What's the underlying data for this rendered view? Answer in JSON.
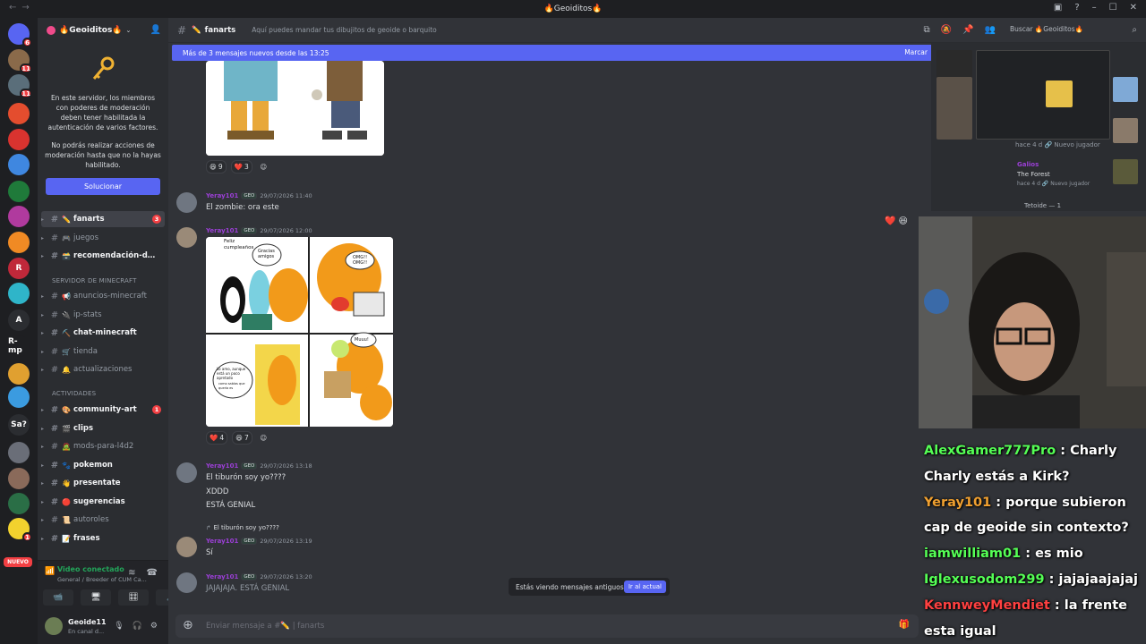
{
  "window": {
    "title": "🔥Geoiditos🔥"
  },
  "guild_rail": {
    "items": [
      {
        "label": "",
        "color": "#5865f2",
        "badge": "6"
      },
      {
        "label": "",
        "color": "#8a6a4a",
        "badge": "11"
      },
      {
        "label": "",
        "color": "#5a6e7a",
        "badge": "11"
      },
      {
        "label": "",
        "color": "#e44d2e",
        "badge": ""
      },
      {
        "label": "",
        "color": "#d9332f",
        "badge": ""
      },
      {
        "label": "",
        "color": "#3f87e0",
        "badge": ""
      },
      {
        "label": "",
        "color": "#1f7a3a",
        "badge": ""
      },
      {
        "label": "",
        "color": "#b03a9e",
        "badge": ""
      },
      {
        "label": "",
        "color": "#f08a24",
        "badge": ""
      },
      {
        "label": "R",
        "color": "#c0283a",
        "badge": ""
      },
      {
        "label": "",
        "color": "#2fb5c9",
        "badge": ""
      },
      {
        "label": "A",
        "color": "#2b2d31",
        "badge": ""
      },
      {
        "label": "R-mp",
        "color": "#1e1f22",
        "badge": ""
      },
      {
        "label": "",
        "color": "#e0a030",
        "badge": ""
      },
      {
        "label": "",
        "color": "#3b9be0",
        "badge": ""
      },
      {
        "label": "Sa?",
        "color": "#2b2d31",
        "badge": ""
      },
      {
        "label": "",
        "color": "#6a6e78",
        "badge": ""
      },
      {
        "label": "",
        "color": "#8a6a5a",
        "badge": ""
      },
      {
        "label": "",
        "color": "#2a6e46",
        "badge": ""
      },
      {
        "label": "",
        "color": "#f2d22e",
        "badge": "1"
      }
    ],
    "nuevo": "NUEVO"
  },
  "server": {
    "name": "🔥Geoiditos🔥",
    "mod_text_1": "En este servidor, los miembros con poderes de moderación deben tener habilitada la autenticación de varios factores.",
    "mod_text_2": "No podrás realizar acciones de moderación hasta que no la hayas habilitado.",
    "fix_button": "Solucionar"
  },
  "channels": [
    {
      "name": "fanarts",
      "emoji": "✏️",
      "active": true,
      "bold": true,
      "badge": "3"
    },
    {
      "name": "juegos",
      "emoji": "🎮",
      "active": false,
      "bold": false,
      "badge": ""
    },
    {
      "name": "recomendación-de...",
      "emoji": "🗃️",
      "active": false,
      "bold": true,
      "badge": ""
    },
    {
      "name": "anuncios-minecraft",
      "emoji": "📢",
      "active": false,
      "bold": false,
      "badge": ""
    },
    {
      "name": "ip-stats",
      "emoji": "🔌",
      "active": false,
      "bold": false,
      "badge": ""
    },
    {
      "name": "chat-minecraft",
      "emoji": "⛏️",
      "active": false,
      "bold": true,
      "badge": ""
    },
    {
      "name": "tienda",
      "emoji": "🛒",
      "active": false,
      "bold": false,
      "badge": ""
    },
    {
      "name": "actualizaciones",
      "emoji": "🔔",
      "active": false,
      "bold": false,
      "badge": ""
    },
    {
      "name": "community-art",
      "emoji": "🎨",
      "active": false,
      "bold": true,
      "badge": "1"
    },
    {
      "name": "clips",
      "emoji": "🎬",
      "active": false,
      "bold": true,
      "badge": ""
    },
    {
      "name": "mods-para-l4d2",
      "emoji": "🧟",
      "active": false,
      "bold": false,
      "badge": ""
    },
    {
      "name": "pokemon",
      "emoji": "🐾",
      "active": false,
      "bold": true,
      "badge": ""
    },
    {
      "name": "presentate",
      "emoji": "👋",
      "active": false,
      "bold": true,
      "badge": ""
    },
    {
      "name": "sugerencias",
      "emoji": "🔴",
      "active": false,
      "bold": true,
      "badge": ""
    },
    {
      "name": "autoroles",
      "emoji": "📜",
      "active": false,
      "bold": false,
      "badge": ""
    },
    {
      "name": "frases",
      "emoji": "📝",
      "active": false,
      "bold": true,
      "badge": ""
    }
  ],
  "categories": {
    "minecraft": "SERVIDOR DE MINECRAFT",
    "activities": "ACTIVIDADES"
  },
  "voice": {
    "title": "Video conectado",
    "subtitle": "General / Breeder of CUM Ca...",
    "btn_camera": "📹",
    "btn_screen": "🖥",
    "btn_activity": "🎛",
    "btn_soundboard": "🎵"
  },
  "user": {
    "name": "Geoide11",
    "status": "En canal d..."
  },
  "channel_header": {
    "name": "fanarts",
    "topic": "Aquí puedes mandar tus dibujitos de geoide o barquito",
    "search": "Buscar 🔥Geoiditos🔥"
  },
  "banner": {
    "text": "Más de 3 mensajes nuevos desde las 13:25",
    "action": "Marcar"
  },
  "messages": [
    {
      "author": "Yeray101",
      "tag": "GEO",
      "time": "29/07/2026 11:40",
      "lines": [
        "El zombie: ora este"
      ]
    },
    {
      "author": "Yeray101",
      "tag": "GEO",
      "time": "29/07/2026 12:00",
      "lines": []
    },
    {
      "author": "Yeray101",
      "tag": "GEO",
      "time": "29/07/2026 13:18",
      "lines": [
        "El tiburón soy yo????",
        "XDDD",
        "ESTÁ GENIAL"
      ]
    },
    {
      "author": "Yeray101",
      "tag": "GEO",
      "time": "29/07/2026 13:19",
      "reply": "El tiburón soy yo????",
      "lines": [
        "Sí"
      ]
    },
    {
      "author": "Yeray101",
      "tag": "GEO",
      "time": "29/07/2026 13:20",
      "lines": [
        "JAJAJAJA. ESTÁ GENIAL"
      ]
    }
  ],
  "reactions_1": [
    {
      "emoji": "😆",
      "count": "9"
    },
    {
      "emoji": "❤️",
      "count": "3"
    }
  ],
  "reactions_2": [
    {
      "emoji": "❤️",
      "count": "4"
    },
    {
      "emoji": "😆",
      "count": "7"
    }
  ],
  "comic": {
    "p1a": "Feliz cumpleaños",
    "p1b": "Gracias amigos",
    "p2": "OMG!! OMG!!",
    "p3a": "Lo amo, aunque está un poco apretado",
    "p3b": "como sabías que quería es",
    "p4": "Muuu!"
  },
  "old_messages": {
    "text": "Estás viendo mensajes antiguos",
    "button": "Ir al actual"
  },
  "composer": {
    "placeholder": "Enviar mensaje a #✏️ | fanarts"
  },
  "members": [
    {
      "name": "Galios",
      "activity": "The Forest",
      "meta": "hace 4 d  🔗 Nuevo jugador"
    },
    {
      "name": "",
      "activity": "",
      "meta": "hace 4 d  🔗 Nuevo jugador"
    }
  ],
  "member_group": "Tetoide — 1",
  "stream_chat": [
    {
      "user": "AlexGamer777Pro",
      "color": "#55ff55",
      "text": ": Charly"
    },
    {
      "user": "",
      "color": "#ffffff",
      "text": "Charly estás a Kirk?"
    },
    {
      "user": "Yeray101",
      "color": "#f0a030",
      "text": ": porque subieron"
    },
    {
      "user": "",
      "color": "#ffffff",
      "text": "cap de geoide sin contexto?"
    },
    {
      "user": "iamwilliam01",
      "color": "#55ff55",
      "text": ": es mio"
    },
    {
      "user": "Iglexusodom299",
      "color": "#55ff55",
      "text": ": jajajaajajaj"
    },
    {
      "user": "KennweyMendiet",
      "color": "#ff4040",
      "text": ": la frente"
    },
    {
      "user": "",
      "color": "#ffffff",
      "text": "esta igual"
    }
  ]
}
